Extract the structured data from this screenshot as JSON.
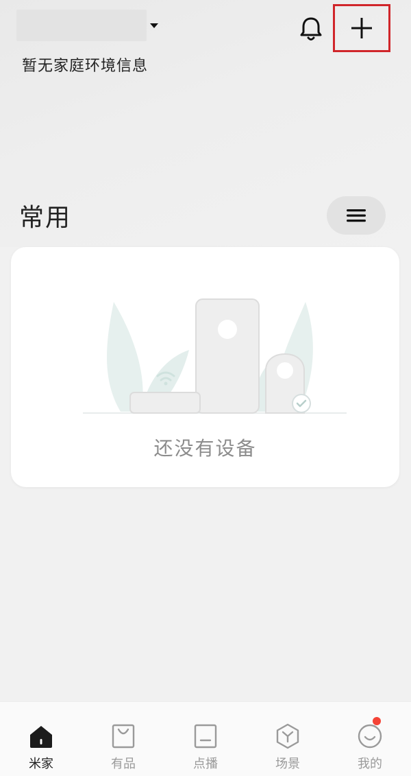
{
  "header": {
    "home_name": "",
    "env_info": "暂无家庭环境信息"
  },
  "section": {
    "title": "常用"
  },
  "empty_card": {
    "message": "还没有设备"
  },
  "tabbar": {
    "tabs": [
      {
        "label": "米家",
        "icon": "home-icon",
        "active": true
      },
      {
        "label": "有品",
        "icon": "shopping-bag-icon",
        "active": false
      },
      {
        "label": "点播",
        "icon": "tv-icon",
        "active": false
      },
      {
        "label": "场景",
        "icon": "scene-cube-icon",
        "active": false
      },
      {
        "label": "我的",
        "icon": "smiley-icon",
        "active": false,
        "badge": true
      }
    ]
  },
  "colors": {
    "highlight": "#d0252a",
    "badge": "#f44336",
    "background": "#f1f1f1"
  }
}
